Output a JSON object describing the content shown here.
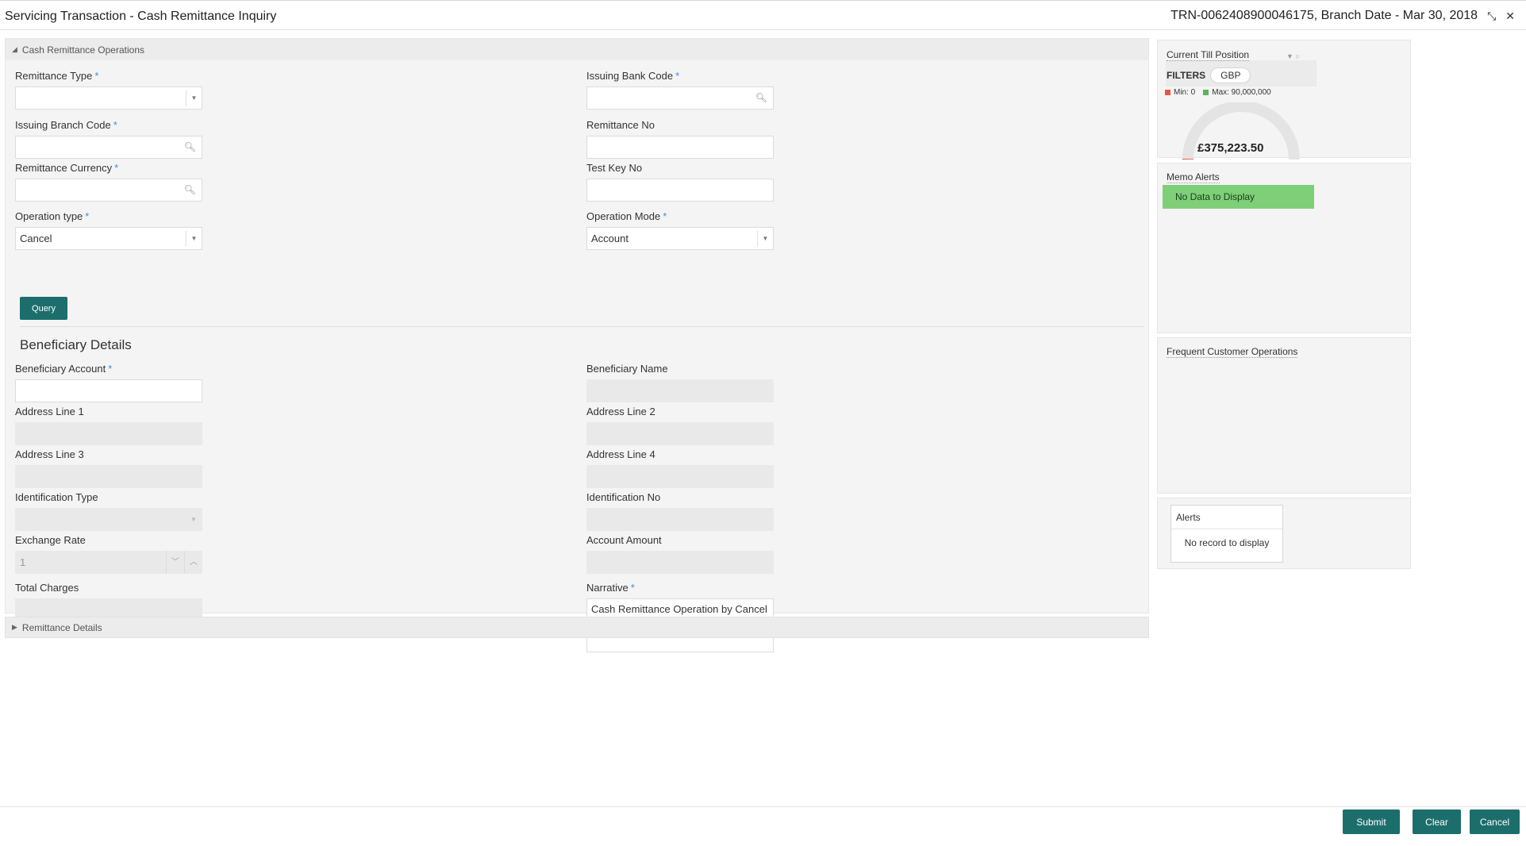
{
  "header": {
    "title": "Servicing Transaction - Cash Remittance Inquiry",
    "txn_info": "TRN-0062408900046175, Branch Date - Mar 30, 2018",
    "minimize_glyph": "⤡",
    "close_glyph": "✕"
  },
  "section_ops": {
    "title": "Cash Remittance Operations"
  },
  "form": {
    "remittance_type": {
      "label": "Remittance Type",
      "value": ""
    },
    "issuing_bank_code": {
      "label": "Issuing Bank Code",
      "value": ""
    },
    "issuing_branch_code": {
      "label": "Issuing Branch Code",
      "value": ""
    },
    "remittance_no": {
      "label": "Remittance No",
      "value": ""
    },
    "remittance_currency": {
      "label": "Remittance Currency",
      "value": ""
    },
    "test_key_no": {
      "label": "Test Key No",
      "value": ""
    },
    "operation_type": {
      "label": "Operation type",
      "value": "Cancel"
    },
    "operation_mode": {
      "label": "Operation Mode",
      "value": "Account"
    },
    "query_button": "Query"
  },
  "beneficiary": {
    "title": "Beneficiary Details",
    "account": {
      "label": "Beneficiary Account",
      "value": ""
    },
    "name": {
      "label": "Beneficiary Name",
      "value": ""
    },
    "address1": {
      "label": "Address Line 1",
      "value": ""
    },
    "address2": {
      "label": "Address Line 2",
      "value": ""
    },
    "address3": {
      "label": "Address Line 3",
      "value": ""
    },
    "address4": {
      "label": "Address Line 4",
      "value": ""
    },
    "id_type": {
      "label": "Identification Type",
      "value": ""
    },
    "id_no": {
      "label": "Identification No",
      "value": ""
    },
    "exchange_rate": {
      "label": "Exchange Rate",
      "value": "1"
    },
    "account_amount": {
      "label": "Account Amount",
      "value": ""
    },
    "total_charges": {
      "label": "Total Charges",
      "value": ""
    },
    "narrative": {
      "label": "Narrative",
      "value": "Cash Remittance Operation by Cancel"
    }
  },
  "section_details": {
    "title": "Remittance Details"
  },
  "till": {
    "title": "Current Till Position",
    "filters_label": "FILTERS",
    "currency": "GBP",
    "min_label": "Min: 0",
    "max_label": "Max: 90,000,000",
    "amount": "£375,223.50",
    "min_color": "#e8563e",
    "max_color": "#5ab55a",
    "gauge_fraction": 0.004
  },
  "memo": {
    "title": "Memo Alerts",
    "empty": "No Data to Display"
  },
  "frequent": {
    "title": "Frequent Customer Operations"
  },
  "alerts": {
    "title": "Alerts",
    "empty": "No record to display"
  },
  "footer": {
    "submit": "Submit",
    "clear": "Clear",
    "cancel": "Cancel"
  },
  "required_mark": "*"
}
